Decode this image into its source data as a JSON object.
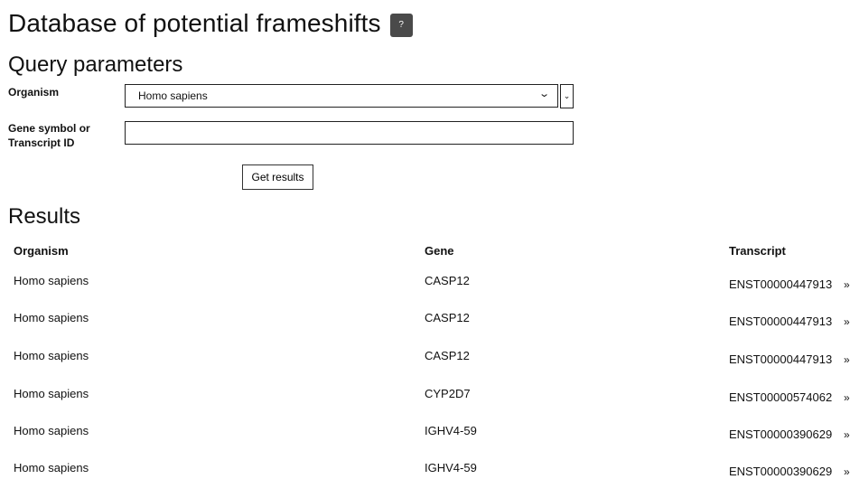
{
  "header": {
    "title": "Database of potential frameshifts",
    "help_label": "?"
  },
  "query": {
    "section_title": "Query parameters",
    "organism_label": "Organism",
    "organism_value": "Homo sapiens",
    "organism_chevron": "⌄",
    "gene_label": "Gene symbol or Transcript ID",
    "gene_value": "",
    "gene_placeholder": "",
    "submit_label": "Get results"
  },
  "results": {
    "section_title": "Results",
    "columns": [
      "Organism",
      "Gene",
      "Transcript"
    ],
    "rows": [
      {
        "organism": "Homo sapiens",
        "gene": "CASP12",
        "transcript": "ENST00000447913"
      },
      {
        "organism": "Homo sapiens",
        "gene": "CASP12",
        "transcript": "ENST00000447913"
      },
      {
        "organism": "Homo sapiens",
        "gene": "CASP12",
        "transcript": "ENST00000447913"
      },
      {
        "organism": "Homo sapiens",
        "gene": "CYP2D7",
        "transcript": "ENST00000574062"
      },
      {
        "organism": "Homo sapiens",
        "gene": "IGHV4-59",
        "transcript": "ENST00000390629"
      },
      {
        "organism": "Homo sapiens",
        "gene": "IGHV4-59",
        "transcript": "ENST00000390629"
      }
    ],
    "row_arrow": "»"
  },
  "icons": {
    "select_chevron": "chevron-down-icon",
    "row_arrow": "double-chevron-right-icon"
  },
  "colors": {
    "help_button_bg": "#4a4a4a",
    "text": "#111111",
    "border": "#222222"
  }
}
